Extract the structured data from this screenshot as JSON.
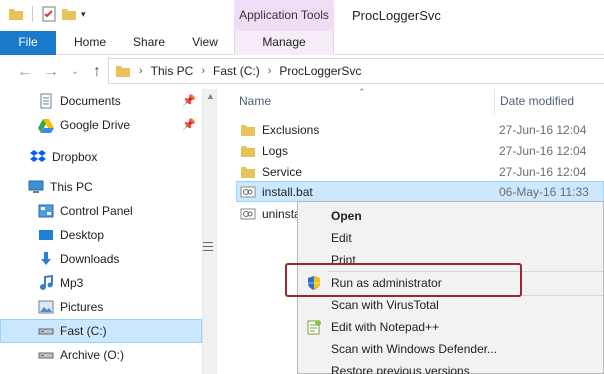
{
  "window": {
    "title": "ProcLoggerSvc",
    "context_tab": "Application Tools"
  },
  "ribbon": {
    "tabs": [
      "File",
      "Home",
      "Share",
      "View",
      "Manage"
    ]
  },
  "address": {
    "crumbs": [
      "This PC",
      "Fast (C:)",
      "ProcLoggerSvc"
    ]
  },
  "nav": {
    "items": [
      {
        "label": "Documents",
        "icon": "documents-icon",
        "pinned": true
      },
      {
        "label": "Google Drive",
        "icon": "google-drive-icon",
        "pinned": true
      },
      {
        "label": "Dropbox",
        "icon": "dropbox-icon"
      },
      {
        "label": "This PC",
        "icon": "computer-icon"
      },
      {
        "label": "Control Panel",
        "icon": "control-panel-icon"
      },
      {
        "label": "Desktop",
        "icon": "desktop-icon"
      },
      {
        "label": "Downloads",
        "icon": "downloads-icon"
      },
      {
        "label": "Mp3",
        "icon": "music-icon"
      },
      {
        "label": "Pictures",
        "icon": "pictures-icon"
      },
      {
        "label": "Fast (C:)",
        "icon": "drive-icon",
        "selected": true
      },
      {
        "label": "Archive (O:)",
        "icon": "drive-icon"
      }
    ]
  },
  "files": {
    "columns": {
      "name": "Name",
      "date": "Date modified"
    },
    "rows": [
      {
        "name": "Exclusions",
        "date": "27-Jun-16 12:04",
        "type": "folder"
      },
      {
        "name": "Logs",
        "date": "27-Jun-16 12:04",
        "type": "folder"
      },
      {
        "name": "Service",
        "date": "27-Jun-16 12:04",
        "type": "folder"
      },
      {
        "name": "install.bat",
        "date": "06-May-16 11:33",
        "type": "batch",
        "selected": true
      },
      {
        "name": "uninsta",
        "date": "",
        "type": "batch"
      }
    ]
  },
  "context_menu": {
    "items": [
      {
        "label": "Open",
        "bold": true
      },
      {
        "label": "Edit"
      },
      {
        "label": "Print"
      },
      {
        "label": "Run as administrator",
        "icon": "uac-shield-icon"
      },
      {
        "label": "Scan with VirusTotal"
      },
      {
        "label": "Edit with Notepad++",
        "icon": "notepad-plus-icon"
      },
      {
        "label": "Scan with Windows Defender..."
      },
      {
        "label": "Restore previous versions"
      }
    ]
  },
  "colors": {
    "file_tab": "#1979ca",
    "context_tab": "#f0dcf4",
    "selection": "#cce8ff",
    "highlight_box": "#a3252c",
    "folder": "#e8c25a"
  }
}
